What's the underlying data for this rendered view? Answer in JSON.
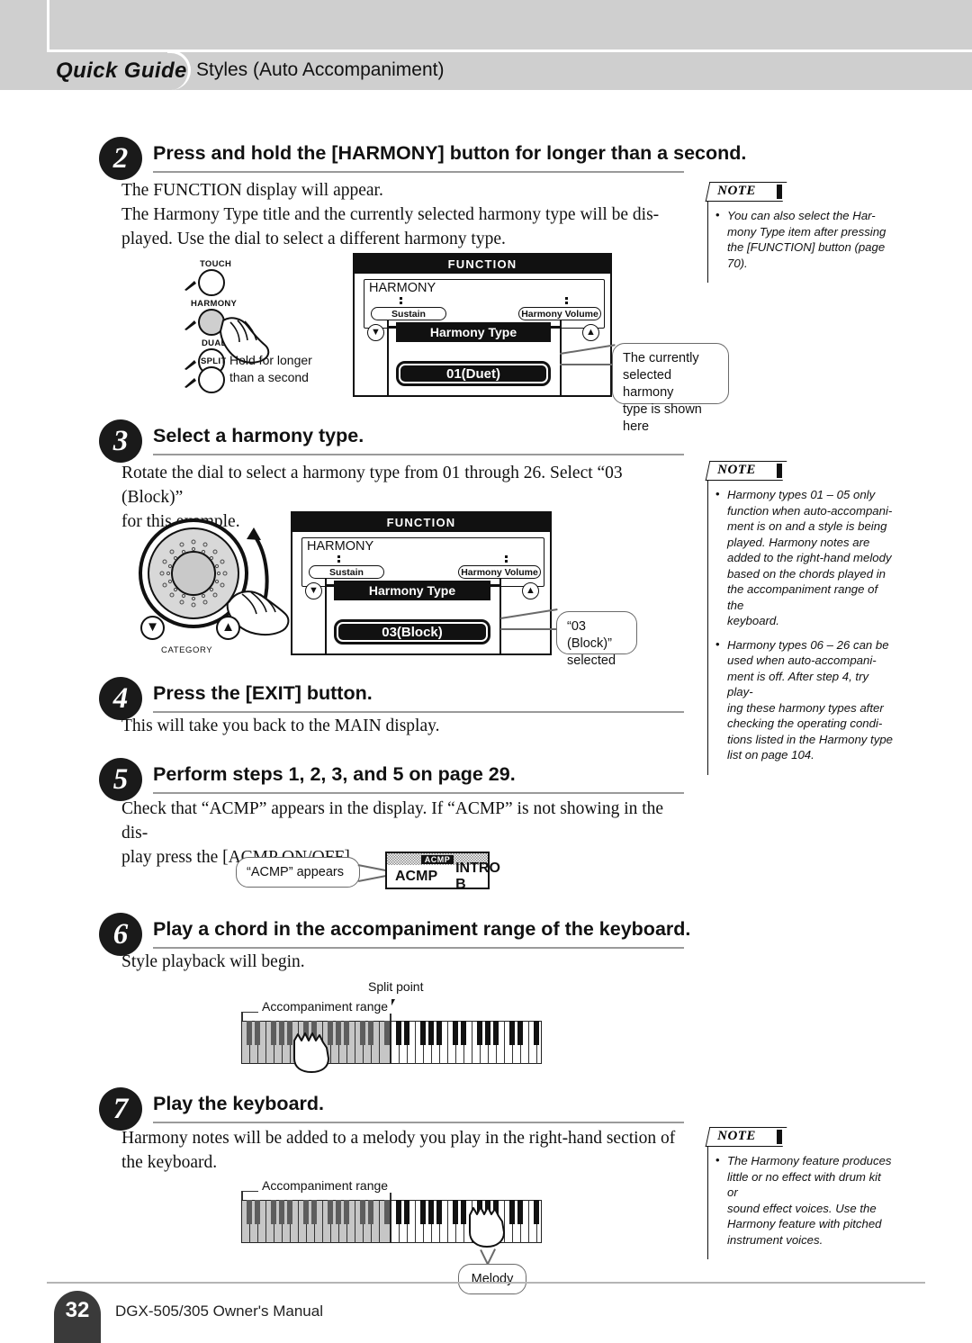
{
  "header": {
    "badge": "Quick Guide",
    "section": "Styles (Auto Accompaniment)"
  },
  "steps": [
    {
      "num": "2",
      "title": "Press and hold the [HARMONY] button for longer than a second.",
      "body_line1": "The FUNCTION display will appear.",
      "body_line2": "The Harmony Type title and the currently selected harmony type will be dis-",
      "body_line3": "played. Use the dial to select a different harmony type."
    },
    {
      "num": "3",
      "title": "Select a harmony type.",
      "body_line1": "Rotate the dial to select a harmony type from 01 through 26. Select “03 (Block)”",
      "body_line2": "for this example."
    },
    {
      "num": "4",
      "title": "Press the [EXIT] button.",
      "body_line1": "This will take you back to the MAIN display."
    },
    {
      "num": "5",
      "title": "Perform steps 1, 2, 3, and 5 on page 29.",
      "body_line1": "Check that “ACMP” appears in the display. If “ACMP” is not showing in the dis-",
      "body_line2": "play press the [ACMP ON/OFF]."
    },
    {
      "num": "6",
      "title": "Play a chord in the accompaniment range of the keyboard.",
      "body_line1": "Style playback will begin."
    },
    {
      "num": "7",
      "title": "Play the keyboard.",
      "body_line1": "Harmony notes will be added to a melody you play in the right-hand section of",
      "body_line2": "the keyboard."
    }
  ],
  "panel_buttons": {
    "labels": [
      "TOUCH",
      "HARMONY",
      "DUAL",
      "SPLIT"
    ],
    "hint_line1": "Hold for longer",
    "hint_line2": "than a second"
  },
  "lcd_step2": {
    "title": "FUNCTION",
    "group": "HARMONY",
    "chip_left": "Sustain",
    "chip_right": "Harmony Volume",
    "item": "Harmony Type",
    "value": "01(Duet)"
  },
  "lcd_step3": {
    "title": "FUNCTION",
    "group": "HARMONY",
    "chip_left": "Sustain",
    "chip_right": "Harmony Volume",
    "item": "Harmony Type",
    "value": "03(Block)"
  },
  "dial": {
    "category_label": "CATEGORY"
  },
  "callouts": {
    "step2_bubble_l1": "The currently",
    "step2_bubble_l2": "selected harmony",
    "step2_bubble_l3": "type is shown here",
    "step3_bubble_l1": "“03 (Block)”",
    "step3_bubble_l2": "selected",
    "acmp_bubble": "“ACMP” appears",
    "melody_bubble": "Melody"
  },
  "acmp_display": {
    "header_tag": "ACMP",
    "left": "ACMP",
    "right": "INTRO B"
  },
  "keyboard_step6": {
    "accompaniment_label": "Accompaniment range",
    "split_point_label": "Split point"
  },
  "keyboard_step7": {
    "accompaniment_label": "Accompaniment range"
  },
  "notes": [
    {
      "label": "NOTE",
      "items": [
        "You can also select the Har-\nmony Type item after pressing\nthe [FUNCTION] button (page\n70)."
      ]
    },
    {
      "label": "NOTE",
      "items": [
        "Harmony types 01 – 05 only\nfunction when auto-accompani-\nment is on and a style is being\nplayed. Harmony notes are\nadded to the right-hand melody\nbased on the chords played in\nthe accompaniment range of the\nkeyboard.",
        "Harmony types 06 – 26 can be\nused when auto-accompani-\nment is off. After step 4, try play-\ning these harmony types after\nchecking the operating condi-\ntions listed in the Harmony type\nlist on page 104."
      ]
    },
    {
      "label": "NOTE",
      "items": [
        "The Harmony feature produces\nlittle or no effect with drum kit or\nsound effect voices. Use the\nHarmony feature with pitched\ninstrument voices."
      ]
    }
  ],
  "footer": {
    "page_number": "32",
    "manual": "DGX-505/305  Owner's Manual"
  },
  "colors": {
    "header_band": "#cfcfcf",
    "ink": "#111111",
    "rule": "#9a9a9a",
    "accent_gray": "#c6c6c6"
  }
}
